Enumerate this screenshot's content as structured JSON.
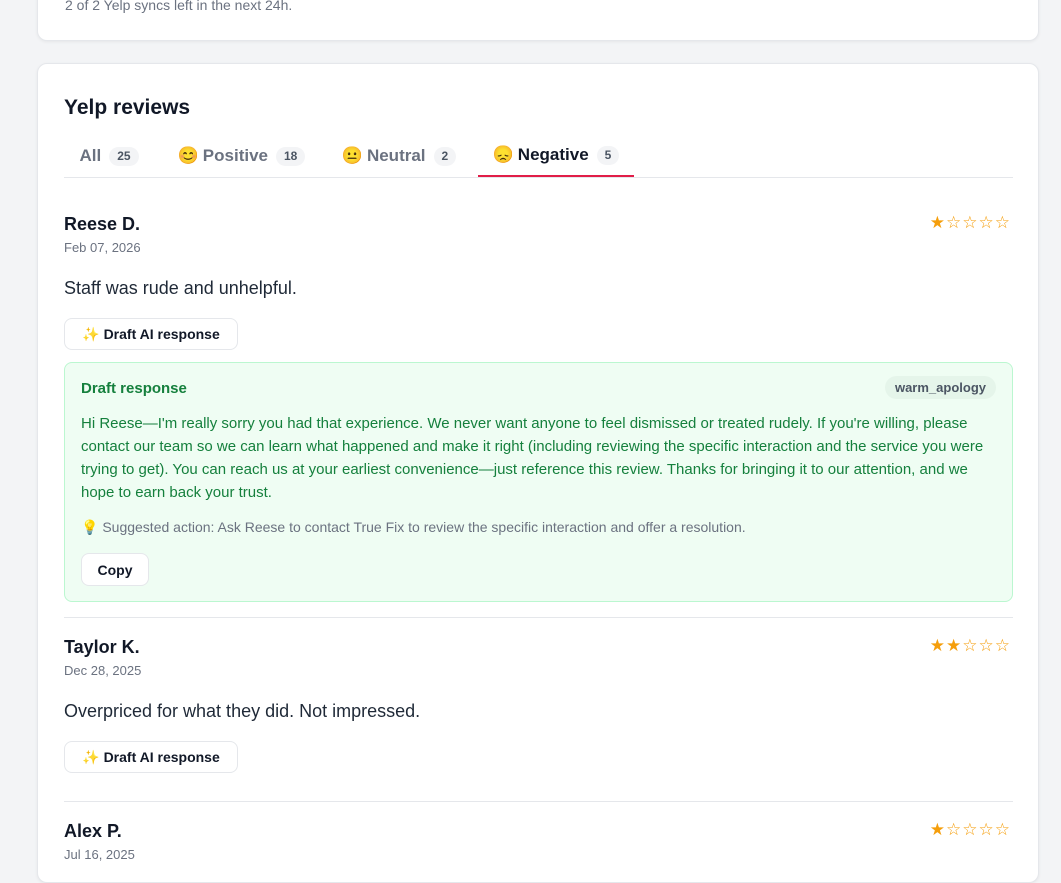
{
  "sync": {
    "note": "2 of 2 Yelp syncs left in the next 24h."
  },
  "section": {
    "title": "Yelp reviews"
  },
  "tabs": [
    {
      "label": "All",
      "emoji": "",
      "count": "25"
    },
    {
      "label": "Positive",
      "emoji": "😊",
      "count": "18"
    },
    {
      "label": "Neutral",
      "emoji": "😐",
      "count": "2"
    },
    {
      "label": "Negative",
      "emoji": "😞",
      "count": "5"
    }
  ],
  "active_tab": "Negative",
  "colors": {
    "accent": "#e11d48",
    "star": "#f59e0b",
    "draft_green": "#15803d"
  },
  "reviews": [
    {
      "name": "Reese D.",
      "date": "Feb 07, 2026",
      "rating": 1,
      "stars": "★☆☆☆☆",
      "text": "Staff was rude and unhelpful.",
      "draft_button": "✨ Draft AI response",
      "draft": {
        "title": "Draft response",
        "tone": "warm_apology",
        "body": "Hi Reese—I'm really sorry you had that experience. We never want anyone to feel dismissed or treated rudely. If you're willing, please contact our team so we can learn what happened and make it right (including reviewing the specific interaction and the service you were trying to get). You can reach us at your earliest convenience—just reference this review. Thanks for bringing it to our attention, and we hope to earn back your trust.",
        "suggestion": "💡 Suggested action: Ask Reese to contact True Fix to review the specific interaction and offer a resolution.",
        "copy_label": "Copy"
      }
    },
    {
      "name": "Taylor K.",
      "date": "Dec 28, 2025",
      "rating": 2,
      "stars": "★★☆☆☆",
      "text": "Overpriced for what they did. Not impressed.",
      "draft_button": "✨ Draft AI response"
    },
    {
      "name": "Alex P.",
      "date": "Jul 16, 2025",
      "rating": 1,
      "stars": "★☆☆☆☆"
    }
  ]
}
